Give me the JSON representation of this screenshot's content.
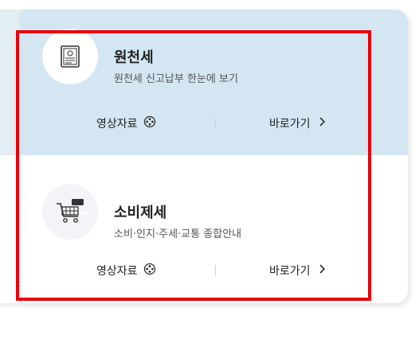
{
  "cards": [
    {
      "title": "원천세",
      "subtitle": "원천세 신고납부 한눈에 보기",
      "video_label": "영상자료",
      "go_label": "바로가기",
      "icon": "document-icon"
    },
    {
      "title": "소비제세",
      "subtitle": "소비·인지·주세·교통 종합안내",
      "video_label": "영상자료",
      "go_label": "바로가기",
      "icon": "tax-cart-icon",
      "icon_badge": "TAX"
    }
  ],
  "colors": {
    "active_card_bg": "#d3e6f2",
    "highlight": "#e8000b"
  }
}
